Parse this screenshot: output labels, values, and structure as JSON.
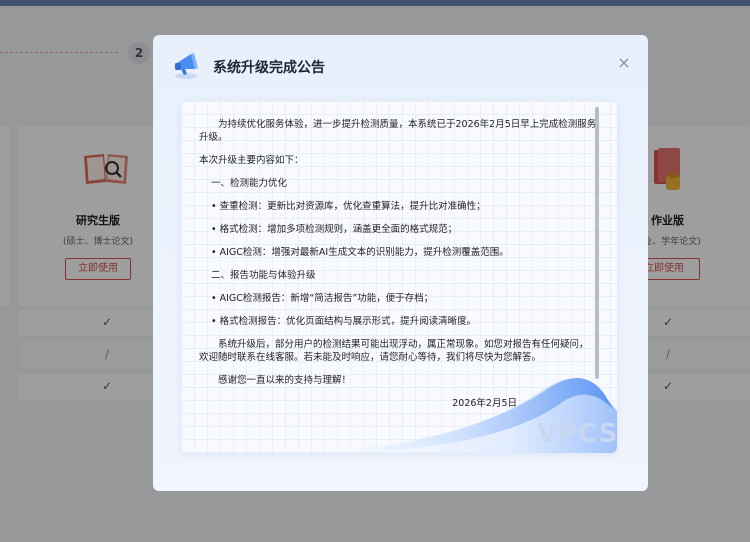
{
  "background": {
    "step_number": "2",
    "left_card": {
      "title": "研究生版",
      "subtitle": "(硕士、博士论文)",
      "button": "立即使用"
    },
    "right_card": {
      "title": "作业版",
      "subtitle": "作业、学年论文)",
      "button": "立即使用"
    },
    "check_mark": "✓",
    "slash_mark": "/"
  },
  "modal": {
    "title": "系统升级完成公告",
    "close_label": "×",
    "watermark": "VPCS",
    "paragraphs": [
      {
        "kind": "intro",
        "text": "为持续优化服务体验，进一步提升检测质量，本系统已于2026年2月5日早上完成检测服务升级。"
      },
      {
        "kind": "plain",
        "text": "本次升级主要内容如下："
      },
      {
        "kind": "section",
        "text": "一、检测能力优化"
      },
      {
        "kind": "item",
        "text": "• 查重检测：更新比对资源库，优化查重算法，提升比对准确性；"
      },
      {
        "kind": "item",
        "text": "• 格式检测：增加多项检测规则，涵盖更全面的格式规范；"
      },
      {
        "kind": "item",
        "text": "• AIGC检测：增强对最新AI生成文本的识别能力，提升检测覆盖范围。"
      },
      {
        "kind": "section",
        "text": "二、报告功能与体验升级"
      },
      {
        "kind": "item",
        "text": "• AIGC检测报告：新增“简洁报告”功能，便于存档；"
      },
      {
        "kind": "item",
        "text": "• 格式检测报告：优化页面结构与展示形式，提升阅读清晰度。"
      },
      {
        "kind": "intro",
        "text": "系统升级后，部分用户的检测结果可能出现浮动，属正常现象。如您对报告有任何疑问，欢迎随时联系在线客服。若未能及时响应，请您耐心等待，我们将尽快为您解答。"
      },
      {
        "kind": "intro",
        "text": "感谢您一直以来的支持与理解！"
      },
      {
        "kind": "date",
        "text": "2026年2月5日"
      }
    ]
  }
}
